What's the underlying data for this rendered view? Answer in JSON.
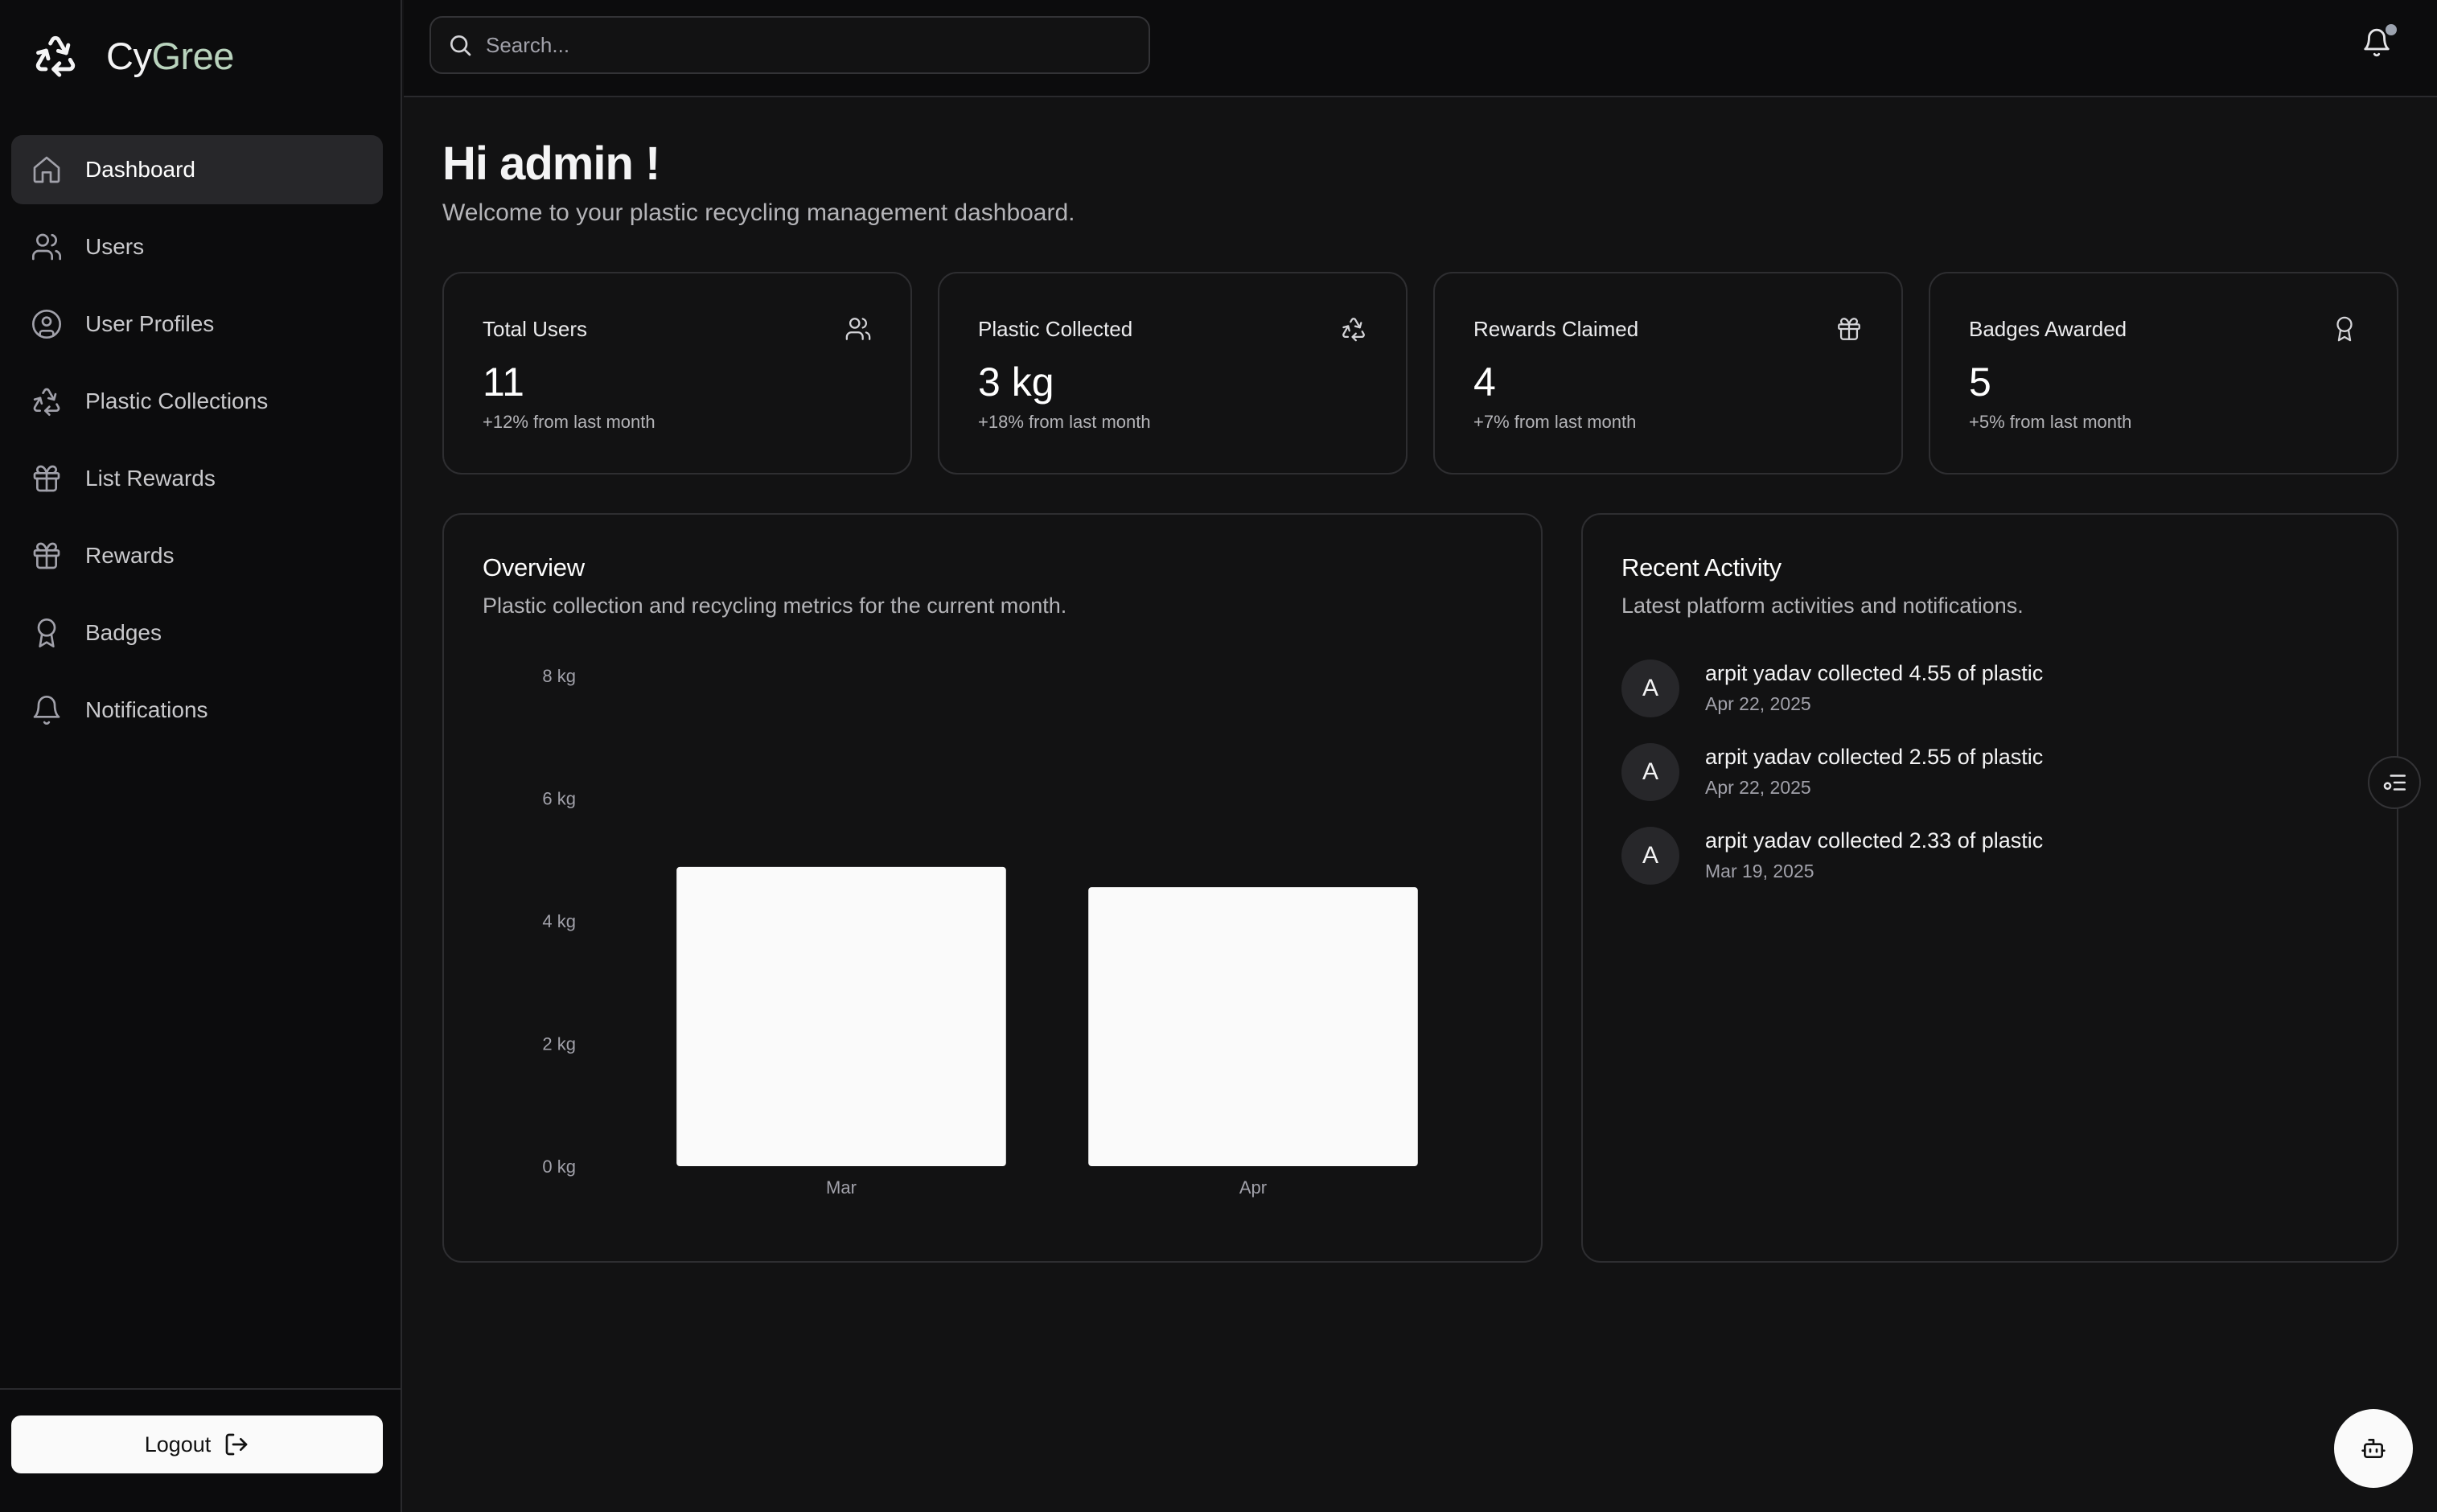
{
  "brand": {
    "name_part1": "Cy",
    "name_part2": "Gree",
    "accent": "#b9d3bd"
  },
  "search": {
    "placeholder": "Search..."
  },
  "sidebar": {
    "items": [
      {
        "label": "Dashboard",
        "icon": "home-icon",
        "active": true
      },
      {
        "label": "Users",
        "icon": "users-icon"
      },
      {
        "label": "User Profiles",
        "icon": "user-circle-icon"
      },
      {
        "label": "Plastic Collections",
        "icon": "recycle-icon"
      },
      {
        "label": "List Rewards",
        "icon": "gift-icon"
      },
      {
        "label": "Rewards",
        "icon": "gift-icon"
      },
      {
        "label": "Badges",
        "icon": "award-icon"
      },
      {
        "label": "Notifications",
        "icon": "bell-icon"
      }
    ],
    "logout_label": "Logout"
  },
  "header": {
    "greeting": "Hi admin !",
    "subtitle": "Welcome to your plastic recycling management dashboard."
  },
  "stats": [
    {
      "label": "Total Users",
      "value": "11",
      "change": "+12% from last month",
      "icon": "users-icon"
    },
    {
      "label": "Plastic Collected",
      "value": "3 kg",
      "change": "+18% from last month",
      "icon": "recycle-icon"
    },
    {
      "label": "Rewards Claimed",
      "value": "4",
      "change": "+7% from last month",
      "icon": "gift-icon"
    },
    {
      "label": "Badges Awarded",
      "value": "5",
      "change": "+5% from last month",
      "icon": "award-icon"
    }
  ],
  "overview": {
    "title": "Overview",
    "description": "Plastic collection and recycling metrics for the current month."
  },
  "chart_data": {
    "type": "bar",
    "categories": [
      "Mar",
      "Apr"
    ],
    "values": [
      4.88,
      4.55
    ],
    "ylim": [
      0,
      8
    ],
    "yticks": [
      0,
      2,
      4,
      6,
      8
    ],
    "ytick_labels": [
      "0 kg",
      "2 kg",
      "4 kg",
      "6 kg",
      "8 kg"
    ],
    "bar_color": "#fafafa",
    "grid": false
  },
  "activity": {
    "title": "Recent Activity",
    "description": "Latest platform activities and notifications.",
    "items": [
      {
        "avatar": "A",
        "text": "arpit yadav collected 4.55 of plastic",
        "date": "Apr 22, 2025"
      },
      {
        "avatar": "A",
        "text": "arpit yadav collected 2.55 of plastic",
        "date": "Apr 22, 2025"
      },
      {
        "avatar": "A",
        "text": "arpit yadav collected 2.33 of plastic",
        "date": "Mar 19, 2025"
      }
    ]
  }
}
